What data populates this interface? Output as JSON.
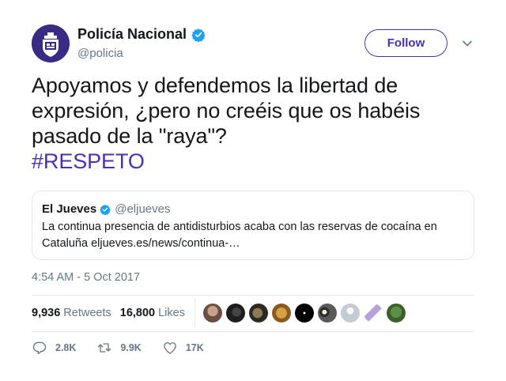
{
  "author": {
    "name": "Policía Nacional",
    "handle": "@policia",
    "avatar_color": "#3a2a86"
  },
  "follow_label": "Follow",
  "tweet": {
    "text": "Apoyamos y defendemos la libertad de expresión, ¿pero no creéis que os habéis pasado de la \"raya\"?",
    "hashtag": "#RESPETO"
  },
  "quoted_tweet": {
    "name": "El Jueves",
    "handle": "@eljueves",
    "text": "La continua presencia de antidisturbios acaba con las reservas de cocaína en Cataluña eljueves.es/news/continua-…"
  },
  "timestamp": "4:54 AM - 5 Oct 2017",
  "stats": {
    "retweets_count": "9,936",
    "retweets_label": "Retweets",
    "likes_count": "16,800",
    "likes_label": "Likes"
  },
  "actions": {
    "replies": "2.8K",
    "retweets": "9.9K",
    "likes": "17K"
  },
  "colors": {
    "accent": "#4b2fb8",
    "verified": "#1da1f2",
    "muted": "#657786"
  },
  "icons": [
    "verified-badge-icon",
    "chevron-down-icon",
    "reply-icon",
    "retweet-icon",
    "like-icon"
  ]
}
